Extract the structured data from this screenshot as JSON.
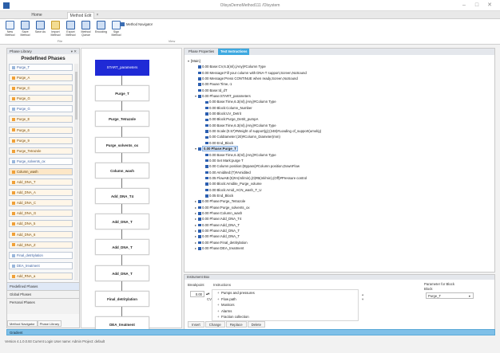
{
  "window": {
    "title": "OlisysDemoMethod111 /Olsystem",
    "controls": [
      "–",
      "□",
      "✕"
    ]
  },
  "tabs": [
    {
      "label": "Home",
      "active": false
    },
    {
      "label": "Method Edit",
      "active": true
    }
  ],
  "ribbon": {
    "buttons": [
      {
        "label": "New Method",
        "icon": "document-icon"
      },
      {
        "label": "Save Method",
        "icon": "disk-icon"
      },
      {
        "label": "Save As",
        "icon": "disk-icon"
      },
      {
        "label": "Import Method",
        "icon": "folder-icon"
      },
      {
        "label": "Export Method",
        "icon": "disk-icon"
      },
      {
        "label": "Method Queue",
        "icon": "disk-icon"
      },
      {
        "label": "Encoding",
        "icon": "disk-icon"
      },
      {
        "label": "Sign Method",
        "icon": "list-icon"
      }
    ],
    "groups": [
      "File",
      "View"
    ],
    "method_navigator_label": "Method Navigator"
  },
  "library": {
    "panel_title": "Phase Library",
    "header": "Predefined Phases",
    "items": [
      {
        "label": "Purge_T",
        "style": "blue"
      },
      {
        "label": "Purge_A",
        "style": "orange"
      },
      {
        "label": "Purge_C",
        "style": "orange"
      },
      {
        "label": "Purge_G",
        "style": "orange"
      },
      {
        "label": "Purge_G",
        "style": "blue"
      },
      {
        "label": "Purge_E",
        "style": "orange"
      },
      {
        "label": "Purge_6",
        "style": "orange"
      },
      {
        "label": "Purge_9",
        "style": "orange"
      },
      {
        "label": "Purge_Tetrazole",
        "style": "orange"
      },
      {
        "label": "Purge_solvents_ox",
        "style": "blue"
      },
      {
        "label": "Column_wash",
        "style": "hl"
      },
      {
        "label": "Add_DNA_T",
        "style": "orange"
      },
      {
        "label": "Add_DNA_A",
        "style": "orange"
      },
      {
        "label": "Add_DNA_C",
        "style": "orange"
      },
      {
        "label": "Add_DNA_G",
        "style": "orange"
      },
      {
        "label": "Add_DNA_5",
        "style": "orange"
      },
      {
        "label": "Add_DNA_6",
        "style": "orange"
      },
      {
        "label": "Add_DNA_Z",
        "style": "orange"
      },
      {
        "label": "Final_detritylation",
        "style": "blue"
      },
      {
        "label": "DEA_treatment",
        "style": "blue"
      },
      {
        "label": "Add_RNA_a",
        "style": "orange"
      }
    ],
    "accordion": [
      "Predefined Phases",
      "Global Phases",
      "Personal Phases"
    ],
    "bottom_tabs": [
      "Method Navigator",
      "Phase Library"
    ]
  },
  "canvas": {
    "start_label": "START_parameters",
    "blocks": [
      "Purge_T",
      "Purge_Tetrazole",
      "Purge_solvents_ox",
      "Column_wash",
      "Add_DNA_T4",
      "Add_DNA_T",
      "Add_DNA_T",
      "Add_DNA_T",
      "Final_detritylation",
      "DEA_treatment"
    ]
  },
  "properties": {
    "tabs": [
      "Phase Properties",
      "Text Instructions"
    ],
    "active_tab": "Text Instructions",
    "tree": [
      {
        "level": 0,
        "expander": "▾",
        "text": "[Main]"
      },
      {
        "level": 1,
        "text": "0.00 Base:CV,6.3(ml),(Any)#Column Type"
      },
      {
        "level": 1,
        "text": "0.00 Message:Fill your column with DNA-T support,Screen,NoSound"
      },
      {
        "level": 1,
        "text": "0.00 Message:Press CONTINUE when ready,Screen,NoSound"
      },
      {
        "level": 1,
        "text": "0.00 Pause:Time,-1"
      },
      {
        "level": 1,
        "text": "0.00 Base:Id_dT"
      },
      {
        "level": 1,
        "expander": "▾",
        "text": "0.00 Phase:START_parameters"
      },
      {
        "level": 2,
        "text": "0.00 Base:Time,6.3(ml),(Any)#Column Type"
      },
      {
        "level": 2,
        "text": "0.00 Block:Column_Number"
      },
      {
        "level": 2,
        "text": "0.00 Block:UV_Detrit"
      },
      {
        "level": 2,
        "text": "0.00 Block:Purge_Detrit_pumpA"
      },
      {
        "level": 2,
        "text": "0.00 Base:Time,6.3(ml),(Any)#Column Type"
      },
      {
        "level": 2,
        "text": "0.00 Scale:(0.57)#Weight of support(g);(248)#Loading of_support(umol/g)"
      },
      {
        "level": 2,
        "text": "0.00 ColdIameter:(20)#Column_Diameter(mm)"
      },
      {
        "level": 2,
        "text": "0.00 End_Block"
      },
      {
        "level": 1,
        "expander": "▾",
        "text": "0.00 Phase:Purge_T",
        "selected": true
      },
      {
        "level": 2,
        "text": "0.00 Base:Time,6.3(ml),(Any)#Column Type"
      },
      {
        "level": 2,
        "text": "0.00 Set Mark:purge T"
      },
      {
        "level": 2,
        "text": "0.00 Column position:(Bypass)#Column position,DownFlow"
      },
      {
        "level": 2,
        "text": "0.00 Amidited:(T)#Amidited"
      },
      {
        "level": 2,
        "text": "0.05 FlowAB:(5)#A(ml/min),(0)#B(ml/min),(Off)#Pressure control"
      },
      {
        "level": 2,
        "text": "0.00 Block:Amidite_Purge_volume"
      },
      {
        "level": 2,
        "text": "0.00 Block:Amid_ACN_wash_T_U"
      },
      {
        "level": 2,
        "text": "0.05 End_Block"
      },
      {
        "level": 1,
        "expander": "▸",
        "text": "0.00 Phase:Purge_Tetrazole"
      },
      {
        "level": 1,
        "expander": "▸",
        "text": "0.00 Phase:Purge_solvents_ox"
      },
      {
        "level": 1,
        "expander": "▸",
        "text": "0.00 Phase:Column_wash"
      },
      {
        "level": 1,
        "expander": "▸",
        "text": "0.00 Phase:Add_DNA_T4"
      },
      {
        "level": 1,
        "expander": "▸",
        "text": "0.00 Phase:Add_DNA_T"
      },
      {
        "level": 1,
        "expander": "▸",
        "text": "0.00 Phase:Add_DNA_T"
      },
      {
        "level": 1,
        "expander": "▸",
        "text": "0.00 Phase:Add_DNA_T"
      },
      {
        "level": 1,
        "expander": "▸",
        "text": "0.00 Phase:Final_detritylation"
      },
      {
        "level": 1,
        "expander": "▸",
        "text": "0.00 Phase:DEA_treatment"
      }
    ]
  },
  "instruction_box": {
    "title": "Instrument Box",
    "breakpoint_label": "Breakpoint",
    "breakpoint_value": "0.00",
    "breakpoint_unit": "CV",
    "instructions_label": "Instructions",
    "instructions": [
      {
        "label": "Pumps and pressures",
        "expander": "+"
      },
      {
        "label": "Flow path",
        "expander": "+"
      },
      {
        "label": "Monitors",
        "expander": "+"
      },
      {
        "label": "Alarms",
        "expander": "+"
      },
      {
        "label": "Fraction collection",
        "expander": "+"
      }
    ],
    "parameter_label": "Parameter for Block",
    "block_label": "Block",
    "block_value": "Purge_T",
    "buttons": [
      "Insert",
      "Change",
      "Replace",
      "Delete"
    ]
  },
  "status": {
    "strip_text": "Gradient",
    "footer_text": "Version 4.1.0.0.93  Current Login User name: Admin   Project: default"
  }
}
